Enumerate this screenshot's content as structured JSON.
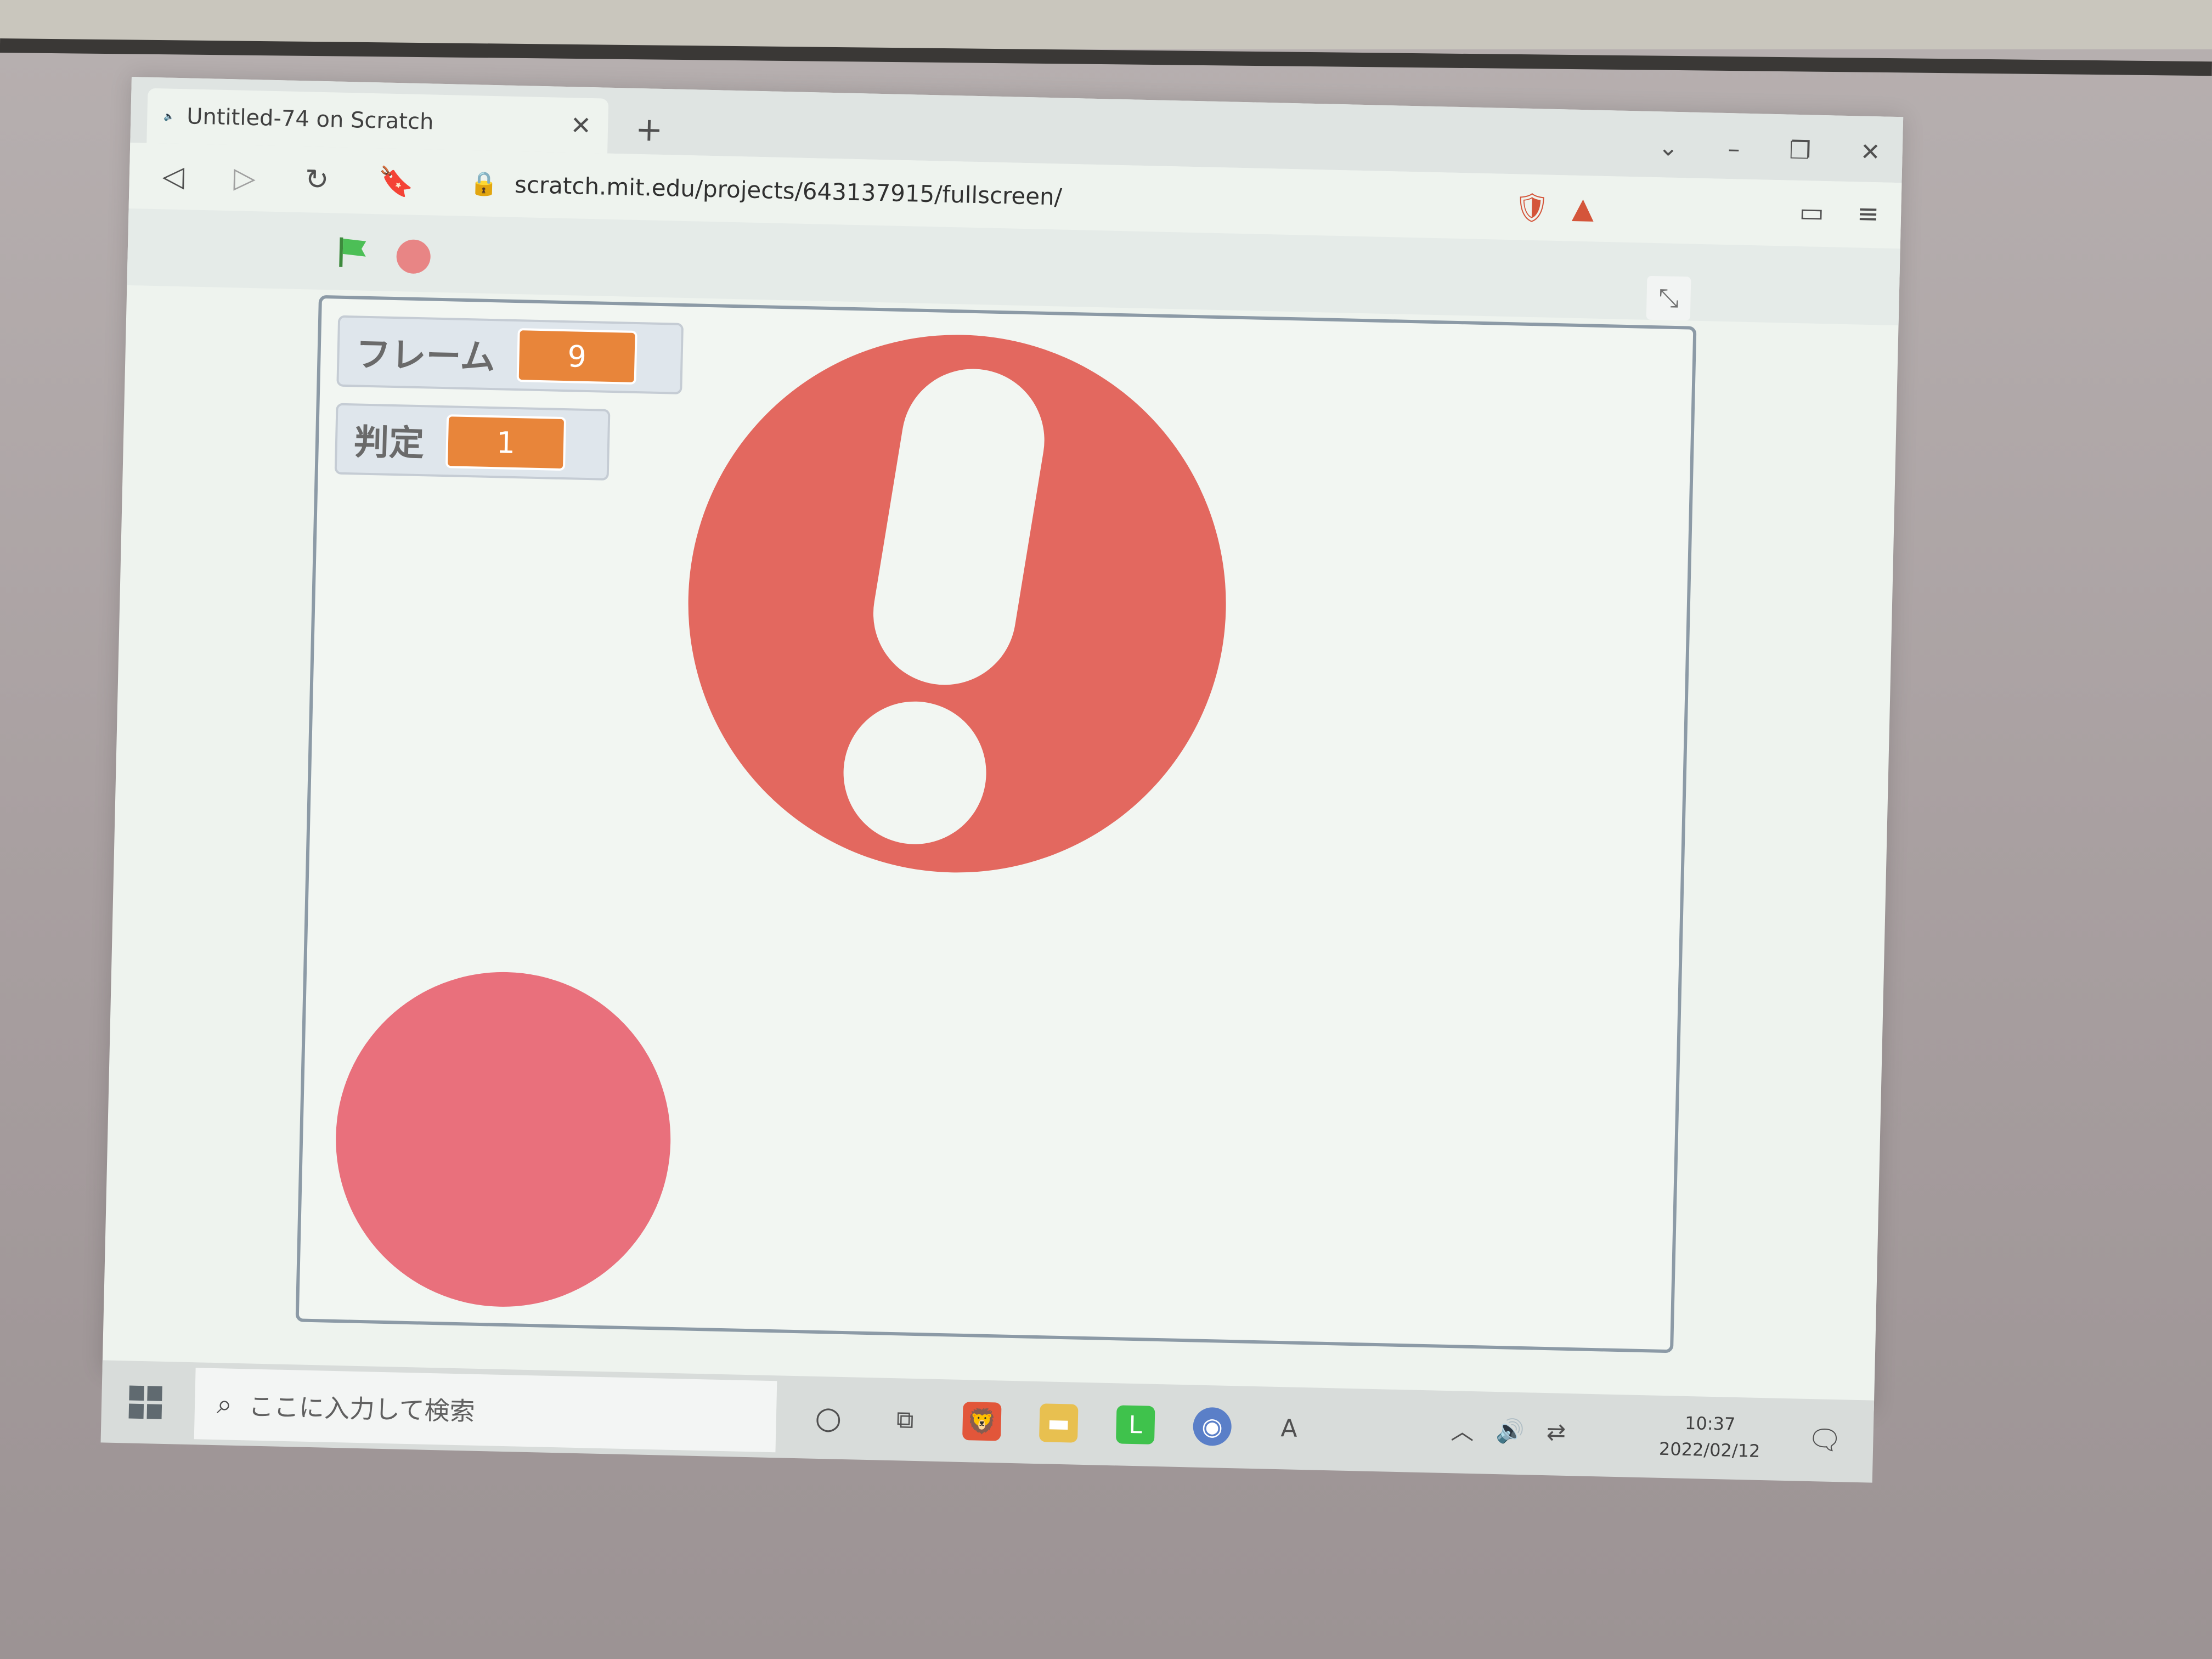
{
  "browser": {
    "tab_title": "Untitled-74 on Scratch",
    "url": "scratch.mit.edu/projects/643137915/fullscreen/"
  },
  "stage": {
    "monitors": [
      {
        "label": "フレーム",
        "value": "9"
      },
      {
        "label": "判定",
        "value": "1"
      }
    ],
    "colors": {
      "big_circle": "#e3685f",
      "small_circle": "#e9707c",
      "monitor_value": "#e8853a"
    }
  },
  "taskbar": {
    "search_placeholder": "ここに入力して検索",
    "time": "10:37",
    "date": "2022/02/12"
  },
  "icons": [
    "speaker-icon",
    "close-icon",
    "plus-icon",
    "back-icon",
    "forward-icon",
    "reload-icon",
    "bookmark-icon",
    "lock-icon",
    "brave-shield-icon",
    "bat-icon",
    "wallet-icon",
    "menu-icon",
    "green-flag-icon",
    "stop-icon",
    "exit-fullscreen-icon",
    "windows-start-icon",
    "search-icon",
    "cortana-icon",
    "task-view-icon",
    "brave-app-icon",
    "file-explorer-icon",
    "line-app-icon",
    "chrome-app-icon",
    "ime-icon",
    "volume-icon",
    "network-icon",
    "notification-icon"
  ]
}
